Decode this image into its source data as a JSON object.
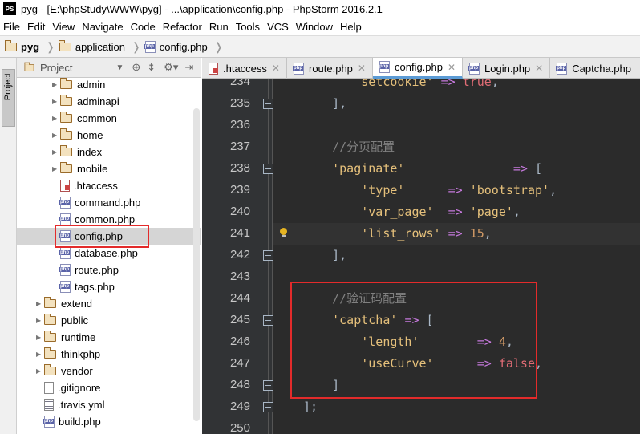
{
  "window": {
    "app_icon": "PS",
    "title": "pyg - [E:\\phpStudy\\WWW\\pyg] - ...\\application\\config.php - PhpStorm 2016.2.1"
  },
  "menu": [
    "File",
    "Edit",
    "View",
    "Navigate",
    "Code",
    "Refactor",
    "Run",
    "Tools",
    "VCS",
    "Window",
    "Help"
  ],
  "breadcrumb": [
    "pyg",
    "application",
    "config.php"
  ],
  "project_panel": {
    "label": "Project",
    "side_tab": "Project",
    "tree": [
      {
        "label": "admin",
        "type": "folder",
        "indent": 1,
        "expandable": true
      },
      {
        "label": "adminapi",
        "type": "folder",
        "indent": 1,
        "expandable": true
      },
      {
        "label": "common",
        "type": "folder",
        "indent": 1,
        "expandable": true
      },
      {
        "label": "home",
        "type": "folder",
        "indent": 1,
        "expandable": true
      },
      {
        "label": "index",
        "type": "folder",
        "indent": 1,
        "expandable": true
      },
      {
        "label": "mobile",
        "type": "folder",
        "indent": 1,
        "expandable": true
      },
      {
        "label": ".htaccess",
        "type": "htaccess",
        "indent": 1,
        "expandable": false
      },
      {
        "label": "command.php",
        "type": "php",
        "indent": 1,
        "expandable": false
      },
      {
        "label": "common.php",
        "type": "php",
        "indent": 1,
        "expandable": false
      },
      {
        "label": "config.php",
        "type": "php",
        "indent": 1,
        "expandable": false,
        "selected": true
      },
      {
        "label": "database.php",
        "type": "php",
        "indent": 1,
        "expandable": false
      },
      {
        "label": "route.php",
        "type": "php",
        "indent": 1,
        "expandable": false
      },
      {
        "label": "tags.php",
        "type": "php",
        "indent": 1,
        "expandable": false
      },
      {
        "label": "extend",
        "type": "folder",
        "indent": 0,
        "expandable": true
      },
      {
        "label": "public",
        "type": "folder",
        "indent": 0,
        "expandable": true
      },
      {
        "label": "runtime",
        "type": "folder",
        "indent": 0,
        "expandable": true
      },
      {
        "label": "thinkphp",
        "type": "folder",
        "indent": 0,
        "expandable": true
      },
      {
        "label": "vendor",
        "type": "folder",
        "indent": 0,
        "expandable": true
      },
      {
        "label": ".gitignore",
        "type": "file",
        "indent": 0,
        "expandable": false
      },
      {
        "label": ".travis.yml",
        "type": "yml",
        "indent": 0,
        "expandable": false
      },
      {
        "label": "build.php",
        "type": "php",
        "indent": 0,
        "expandable": false
      }
    ]
  },
  "tabs": [
    {
      "label": ".htaccess",
      "type": "htaccess",
      "active": false
    },
    {
      "label": "route.php",
      "type": "php",
      "active": false
    },
    {
      "label": "config.php",
      "type": "php",
      "active": true
    },
    {
      "label": "Login.php",
      "type": "php",
      "active": false
    },
    {
      "label": "Captcha.php",
      "type": "php",
      "active": false
    }
  ],
  "code_lines": [
    {
      "num": "234",
      "tokens": [
        [
          "s",
          "setcookie'"
        ],
        [
          "op",
          " => "
        ],
        [
          "b",
          "true"
        ],
        [
          "k",
          ","
        ]
      ],
      "indent": "        "
    },
    {
      "num": "235",
      "tokens": [
        [
          "k",
          "],"
        ]
      ],
      "indent": "    ",
      "fold": true
    },
    {
      "num": "236",
      "tokens": [],
      "indent": ""
    },
    {
      "num": "237",
      "tokens": [
        [
          "c",
          "//分页配置"
        ]
      ],
      "indent": "    "
    },
    {
      "num": "238",
      "tokens": [
        [
          "s",
          "'paginate'"
        ],
        [
          "k",
          "               "
        ],
        [
          "op",
          "=> "
        ],
        [
          "k",
          "["
        ]
      ],
      "indent": "    ",
      "fold": true
    },
    {
      "num": "239",
      "tokens": [
        [
          "s",
          "'type'"
        ],
        [
          "k",
          "      "
        ],
        [
          "op",
          "=> "
        ],
        [
          "s",
          "'bootstrap'"
        ],
        [
          "k",
          ","
        ]
      ],
      "indent": "        "
    },
    {
      "num": "240",
      "tokens": [
        [
          "s",
          "'var_page'"
        ],
        [
          "k",
          "  "
        ],
        [
          "op",
          "=> "
        ],
        [
          "s",
          "'page'"
        ],
        [
          "k",
          ","
        ]
      ],
      "indent": "        "
    },
    {
      "num": "241",
      "tokens": [
        [
          "s",
          "'list_rows'"
        ],
        [
          "k",
          " "
        ],
        [
          "op",
          "=> "
        ],
        [
          "n",
          "15"
        ],
        [
          "k",
          ","
        ]
      ],
      "indent": "        ",
      "current": true,
      "bulb": true
    },
    {
      "num": "242",
      "tokens": [
        [
          "k",
          "],"
        ]
      ],
      "indent": "    ",
      "fold": true
    },
    {
      "num": "243",
      "tokens": [],
      "indent": ""
    },
    {
      "num": "244",
      "tokens": [
        [
          "c",
          "//验证码配置"
        ]
      ],
      "indent": "    "
    },
    {
      "num": "245",
      "tokens": [
        [
          "s",
          "'captcha'"
        ],
        [
          "k",
          " "
        ],
        [
          "op",
          "=> "
        ],
        [
          "k",
          "["
        ]
      ],
      "indent": "    ",
      "fold": true
    },
    {
      "num": "246",
      "tokens": [
        [
          "s",
          "'length'"
        ],
        [
          "k",
          "        "
        ],
        [
          "op",
          "=> "
        ],
        [
          "n",
          "4"
        ],
        [
          "k",
          ","
        ]
      ],
      "indent": "        "
    },
    {
      "num": "247",
      "tokens": [
        [
          "s",
          "'useCurve'"
        ],
        [
          "k",
          "      "
        ],
        [
          "op",
          "=> "
        ],
        [
          "b",
          "false"
        ],
        [
          "k",
          ","
        ]
      ],
      "indent": "        "
    },
    {
      "num": "248",
      "tokens": [
        [
          "k",
          "]"
        ]
      ],
      "indent": "    ",
      "fold": true
    },
    {
      "num": "249",
      "tokens": [
        [
          "k",
          "];"
        ]
      ],
      "indent": "",
      "fold": true
    },
    {
      "num": "250",
      "tokens": [],
      "indent": ""
    }
  ],
  "colors": {
    "annotation": "#e32b2b",
    "editor_bg": "#2b2b2b",
    "gutter_bg": "#313335"
  }
}
